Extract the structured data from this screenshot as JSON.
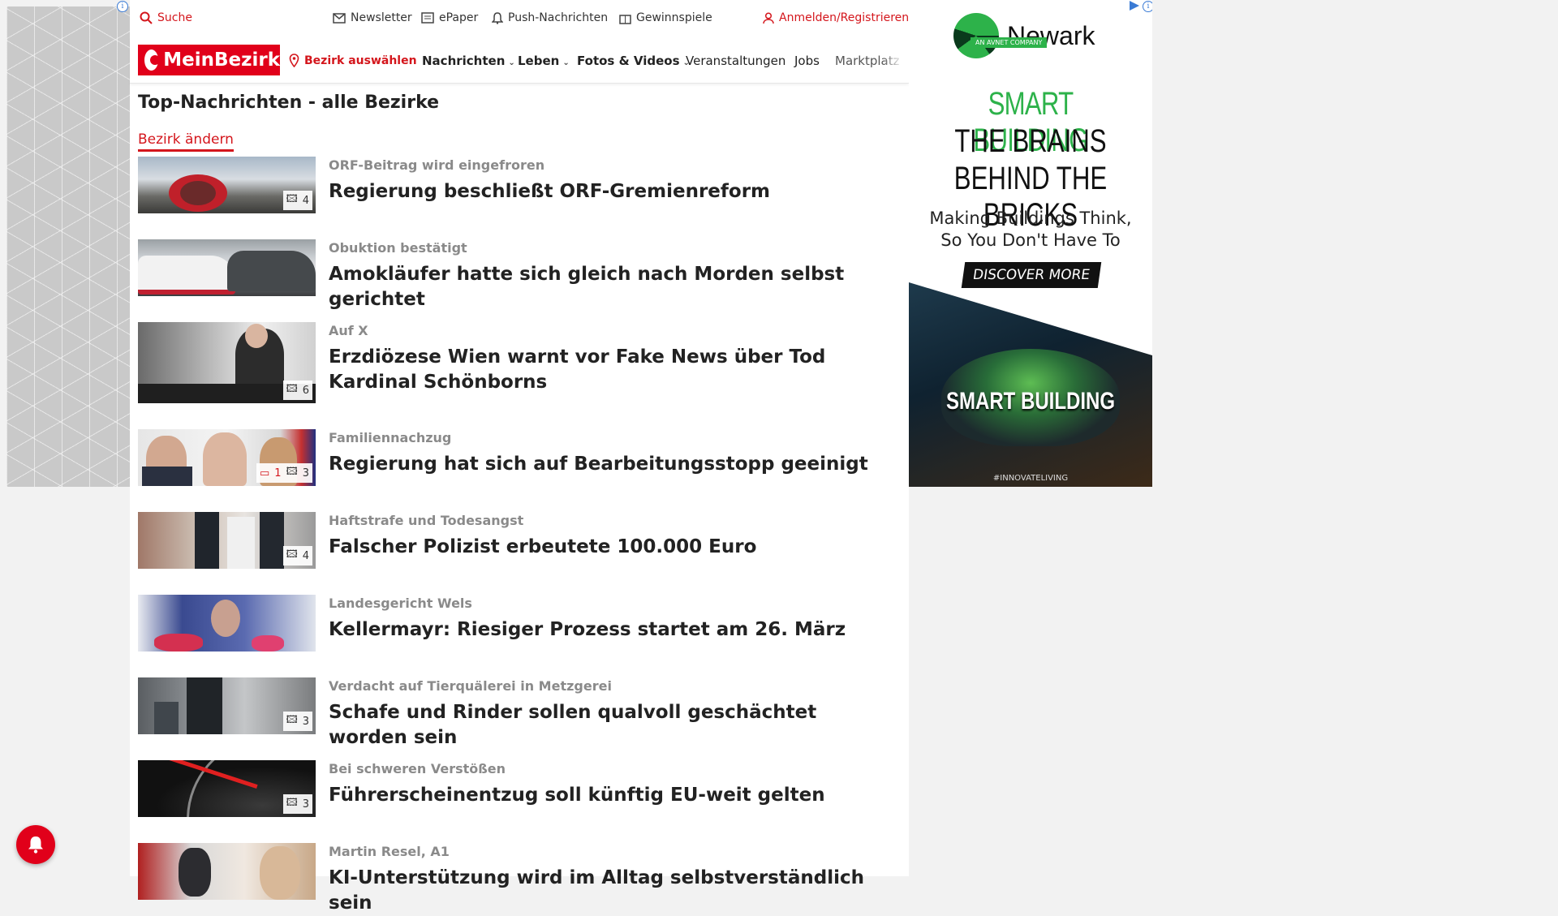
{
  "top_bar": {
    "search": "Suche",
    "newsletter": "Newsletter",
    "epaper": "ePaper",
    "push": "Push-Nachrichten",
    "gewinnspiele": "Gewinnspiele",
    "login": "Anmelden/Registrieren"
  },
  "nav": {
    "logo_text": "MeinBezirk",
    "bezirk": "Bezirk auswählen",
    "items": [
      "Nachrichten",
      "Leben",
      "Fotos & Videos",
      "Veranstaltungen",
      "Jobs",
      "Marktplatz"
    ]
  },
  "main": {
    "title": "Top-Nachrichten - alle Bezirke",
    "change_link": "Bezirk ändern",
    "articles": [
      {
        "kicker": "ORF-Beitrag wird eingefroren",
        "headline": "Regierung beschließt ORF-Gremienreform",
        "images": "4"
      },
      {
        "kicker": "Obuktion bestätigt",
        "headline": "Amokläufer hatte sich gleich nach Morden selbst gerichtet"
      },
      {
        "kicker": "Auf X",
        "headline": "Erzdiözese Wien warnt vor Fake News über Tod Kardinal Schönborns",
        "images": "6"
      },
      {
        "kicker": "Familiennachzug",
        "headline": "Regierung hat sich auf Bearbeitungsstopp geeinigt",
        "comments": "1",
        "images": "3"
      },
      {
        "kicker": "Haftstrafe und Todesangst",
        "headline": "Falscher Polizist erbeutete 100.000 Euro",
        "images": "4"
      },
      {
        "kicker": "Landesgericht Wels",
        "headline": "Kellermayr: Riesiger Prozess startet am 26. März"
      },
      {
        "kicker": "Verdacht auf Tierquälerei in Metzgerei",
        "headline": "Schafe und Rinder sollen qualvoll geschächtet worden sein",
        "images": "3"
      },
      {
        "kicker": "Bei schweren Verstößen",
        "headline": "Führerscheinentzug soll künftig EU-weit gelten",
        "images": "3"
      },
      {
        "kicker": "Martin Resel, A1",
        "headline": "KI-Unterstützung wird im Alltag selbstverständlich sein"
      }
    ]
  },
  "ad": {
    "brand": "Newark",
    "brand_sub": "AN AVNET COMPANY",
    "line1": "SMART BUILDING",
    "line2": "THE BRAINS",
    "line3": "BEHIND THE BRICKS",
    "sub1": "Making Buildings Think,",
    "sub2": "So You Don't Have To",
    "cta": "DISCOVER MORE",
    "image_text": "SMART BUILDING",
    "tag": "#INNOVATELIVING"
  },
  "colors": {
    "brand_red": "#e1001a",
    "ad_green": "#2db24a"
  }
}
